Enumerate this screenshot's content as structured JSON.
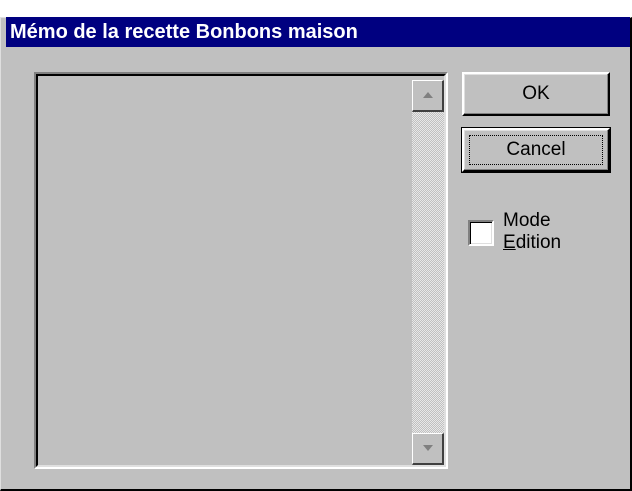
{
  "window": {
    "title": "Mémo de la recette Bonbons maison"
  },
  "memo": {
    "value": ""
  },
  "scrollbar": {
    "up_icon": "arrow-up-icon",
    "down_icon": "arrow-down-icon"
  },
  "buttons": {
    "ok_label": "OK",
    "cancel_label": "Cancel"
  },
  "mode_edition": {
    "label_line1": "Mode",
    "label_line2_mnemonic": "E",
    "label_line2_rest": "dition",
    "checked": false
  },
  "colors": {
    "title_bar": "#000080",
    "face": "#c0c0c0"
  }
}
